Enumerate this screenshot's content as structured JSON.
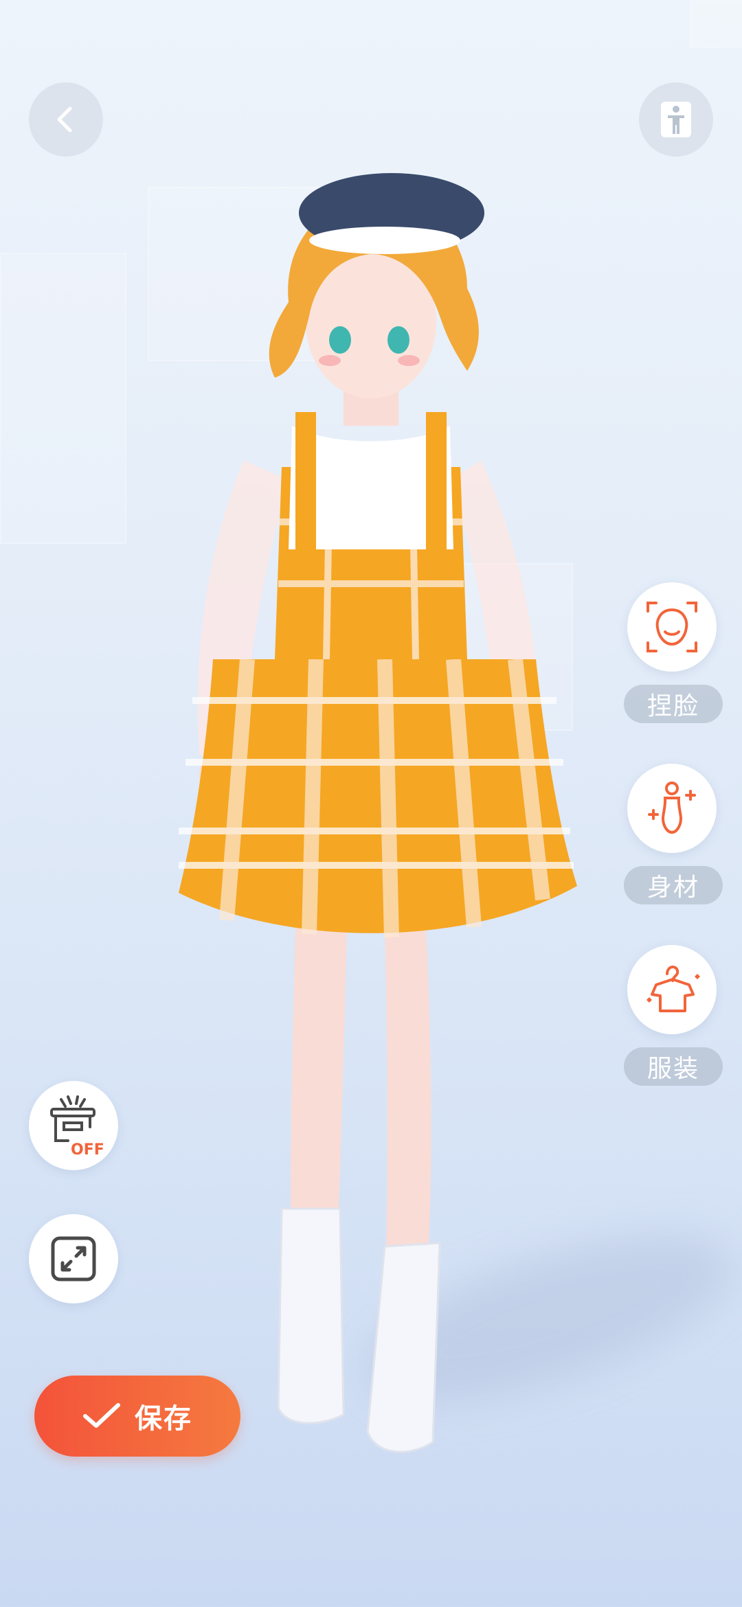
{
  "header": {
    "back_icon": "chevron-left-icon",
    "pose_icon": "standing-figure-icon"
  },
  "avatar": {
    "description_icon": "anime-character-3d-model",
    "hair_color": "#f2a93a",
    "dress_color": "#f5a623",
    "beret_color": "#3a4a6b"
  },
  "side_menu": [
    {
      "label": "捏脸",
      "icon": "face-shape-icon"
    },
    {
      "label": "身材",
      "icon": "body-shape-icon"
    },
    {
      "label": "服装",
      "icon": "clothing-hanger-icon"
    }
  ],
  "left_tools": {
    "stage_toggle": {
      "icon": "stage-light-off-icon",
      "badge": "OFF"
    },
    "fullscreen": {
      "icon": "expand-arrows-icon"
    }
  },
  "save_button": {
    "label": "保存",
    "icon": "check-icon"
  },
  "colors": {
    "accent": "#f2643a",
    "accent_gradient_end": "#f57a3f",
    "label_bg": "#aab4c3"
  }
}
